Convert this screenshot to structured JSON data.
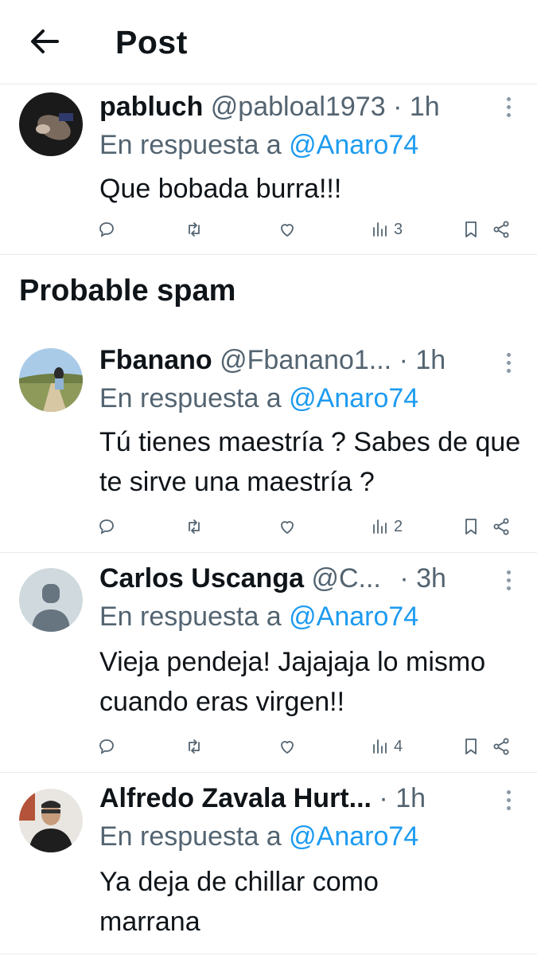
{
  "header": {
    "title": "Post"
  },
  "spam_section": {
    "heading": "Probable spam"
  },
  "tweets": [
    {
      "name": "pabluch",
      "handle": "@pabloal1973",
      "time": "· 1h",
      "reply_prefix": "En respuesta a",
      "reply_mention": "@Anaro74",
      "text": "Que bobada burra!!!",
      "views": "3"
    },
    {
      "name": "Fbanano",
      "handle": "@Fbanano1...",
      "time": "· 1h",
      "reply_prefix": "En respuesta a",
      "reply_mention": "@Anaro74",
      "text": "Tú tienes maestría ? Sabes de que te sirve una maestría ?",
      "views": "2"
    },
    {
      "name": "Carlos Uscanga",
      "handle": "@C...",
      "time": "· 3h",
      "reply_prefix": "En respuesta a",
      "reply_mention": "@Anaro74",
      "text": "Vieja pendeja! Jajajaja lo mismo cuando eras virgen!!",
      "views": "4"
    },
    {
      "name": "Alfredo Zavala Hurt...",
      "handle": "",
      "time": "· 1h",
      "reply_prefix": "En respuesta a",
      "reply_mention": "@Anaro74",
      "text": "Ya deja de chillar como marrana"
    }
  ],
  "icons": {
    "back": "arrow-left-icon",
    "more": "more-vertical-icon",
    "reply": "comment-icon",
    "retweet": "retweet-icon",
    "like": "heart-icon",
    "views": "views-chart-icon",
    "bookmark": "bookmark-icon",
    "share": "share-icon"
  },
  "colors": {
    "text": "#0f1419",
    "secondary": "#536471",
    "link": "#1d9bf0",
    "divider": "#e6e9ec"
  }
}
